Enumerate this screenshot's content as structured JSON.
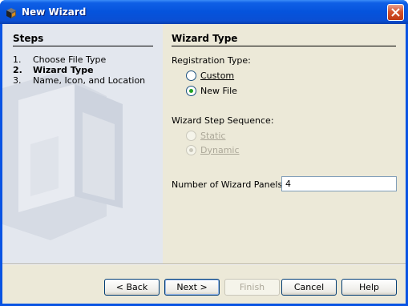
{
  "window": {
    "title": "New Wizard"
  },
  "steps": {
    "header": "Steps",
    "items": [
      {
        "num": "1.",
        "label": "Choose File Type",
        "current": false
      },
      {
        "num": "2.",
        "label": "Wizard Type",
        "current": true
      },
      {
        "num": "3.",
        "label": "Name, Icon, and Location",
        "current": false
      }
    ]
  },
  "content": {
    "header": "Wizard Type",
    "registration": {
      "label": "Registration Type:",
      "options": [
        "Custom",
        "New File"
      ],
      "selected": "New File"
    },
    "sequence": {
      "label": "Wizard Step Sequence:",
      "options": [
        "Static",
        "Dynamic"
      ],
      "selected": "Dynamic",
      "enabled": false
    },
    "panels": {
      "label": "Number of Wizard Panels:",
      "value": "4"
    }
  },
  "buttons": {
    "back": "< Back",
    "next": "Next >",
    "finish": "Finish",
    "cancel": "Cancel",
    "help": "Help"
  },
  "colors": {
    "titlebar": "#0a54e3",
    "client": "#ece9d8",
    "radio_checked": "#21a121",
    "disabled_text": "#aca899"
  }
}
